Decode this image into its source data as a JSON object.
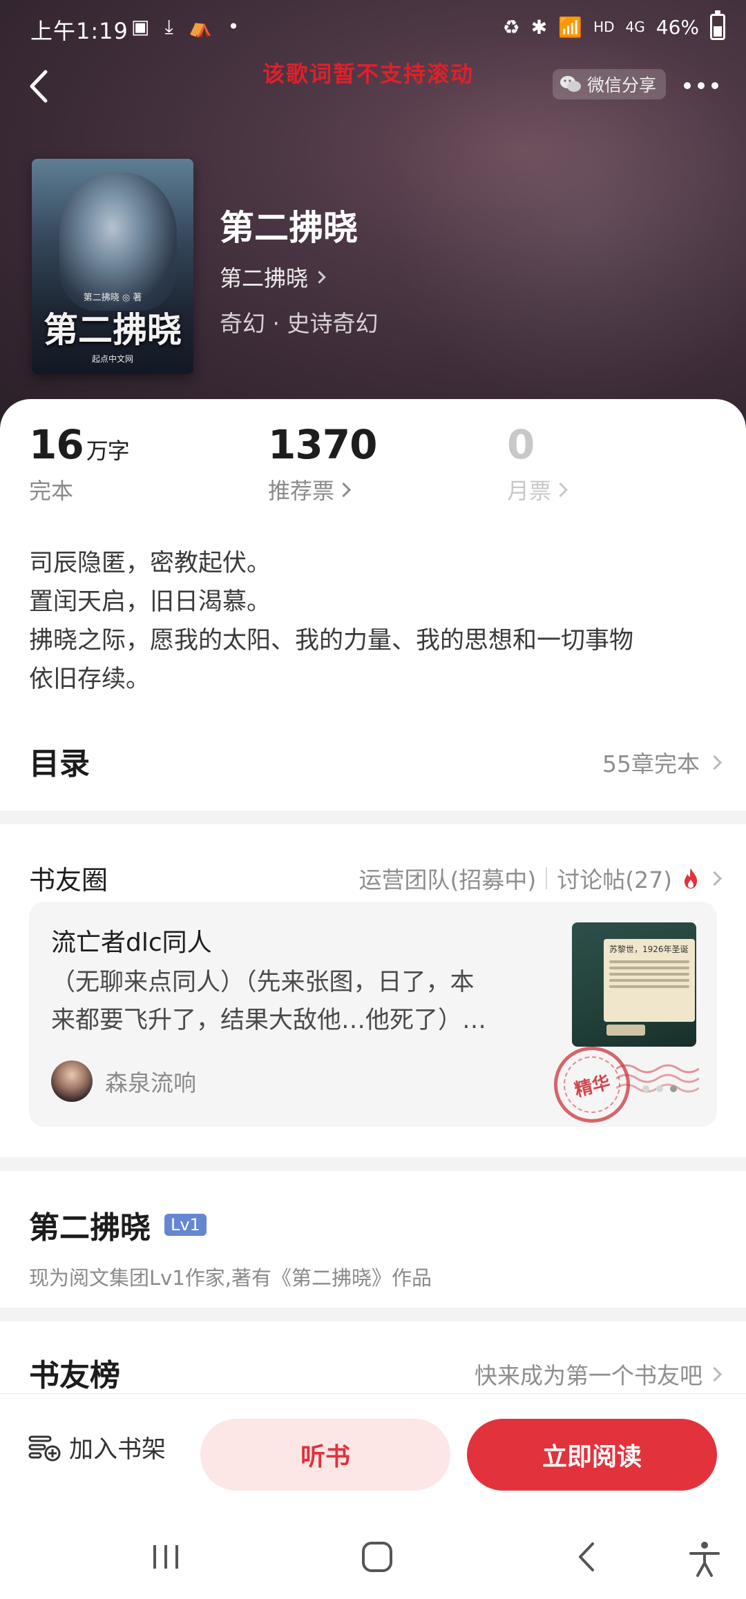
{
  "status_bar": {
    "time": "上午1:19",
    "network": "HD",
    "signal": "4G",
    "battery": "46%"
  },
  "nav": {
    "lyrics_notice": "该歌词暂不支持滚动",
    "share_label": "微信分享"
  },
  "book": {
    "title": "第二拂晓",
    "author": "第二拂晓",
    "genre": "奇幻 · 史诗奇幻",
    "cover": {
      "title": "第二拂晓",
      "author_line": "第二拂晓 ◎ 著",
      "publisher": "起点中文网"
    }
  },
  "stats": {
    "words": {
      "value": "16",
      "unit": "万字",
      "label": "完本"
    },
    "recommend": {
      "value": "1370",
      "label": "推荐票"
    },
    "monthly": {
      "value": "0",
      "label": "月票"
    }
  },
  "synopsis": [
    "司辰隐匿，密教起伏。",
    "置闰天启，旧日渴慕。",
    "拂晓之际，愿我的太阳、我的力量、我的思想和一切事物",
    "依旧存续。"
  ],
  "toc": {
    "title": "目录",
    "status": "55章完本"
  },
  "book_circle": {
    "title": "书友圈",
    "team_link": "运营团队(招募中)",
    "discussion_link": "讨论帖(27)",
    "post": {
      "title": "流亡者dlc同人",
      "excerpt_lines": [
        "（无聊来点同人）（先来张图，日了，本",
        "来都要飞升了，结果大敌他…他死了）…"
      ],
      "username": "森泉流响",
      "thumb_caption": "苏黎世，1926年圣诞",
      "badge": "精华"
    }
  },
  "author_section": {
    "name": "第二拂晓",
    "level": "Lv1",
    "description": "现为阅文集团Lv1作家,著有《第二拂晓》作品"
  },
  "fan_rank": {
    "title": "书友榜",
    "cta": "快来成为第一个书友吧"
  },
  "actions": {
    "add_shelf": "加入书架",
    "listen": "听书",
    "read_now": "立即阅读"
  },
  "colors": {
    "accent_red": "#e2323c",
    "listen_bg": "#fde6e6",
    "level_badge": "#6687d0"
  }
}
